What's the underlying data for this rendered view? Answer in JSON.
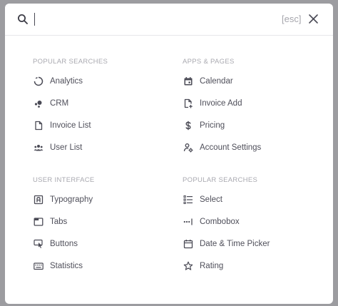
{
  "search": {
    "placeholder": "",
    "value": "",
    "esc_label": "[esc]"
  },
  "sections": [
    {
      "title": "POPULAR SEARCHES",
      "items": [
        {
          "label": "Analytics",
          "icon": "chart-donut-icon"
        },
        {
          "label": "CRM",
          "icon": "chart-dots-icon"
        },
        {
          "label": "Invoice List",
          "icon": "file-icon"
        },
        {
          "label": "User List",
          "icon": "users-icon"
        }
      ]
    },
    {
      "title": "APPS & PAGES",
      "items": [
        {
          "label": "Calendar",
          "icon": "calendar-icon"
        },
        {
          "label": "Invoice Add",
          "icon": "file-plus-icon"
        },
        {
          "label": "Pricing",
          "icon": "currency-dollar-icon"
        },
        {
          "label": "Account Settings",
          "icon": "user-cog-icon"
        }
      ]
    },
    {
      "title": "USER INTERFACE",
      "items": [
        {
          "label": "Typography",
          "icon": "letter-a-icon"
        },
        {
          "label": "Tabs",
          "icon": "browser-icon"
        },
        {
          "label": "Buttons",
          "icon": "hand-click-icon"
        },
        {
          "label": "Statistics",
          "icon": "keyboard-icon"
        }
      ]
    },
    {
      "title": "POPULAR SEARCHES",
      "items": [
        {
          "label": "Select",
          "icon": "list-check-icon"
        },
        {
          "label": "Combobox",
          "icon": "dots-cursor-icon"
        },
        {
          "label": "Date & Time Picker",
          "icon": "calendar-grid-icon"
        },
        {
          "label": "Rating",
          "icon": "star-icon"
        }
      ]
    }
  ]
}
